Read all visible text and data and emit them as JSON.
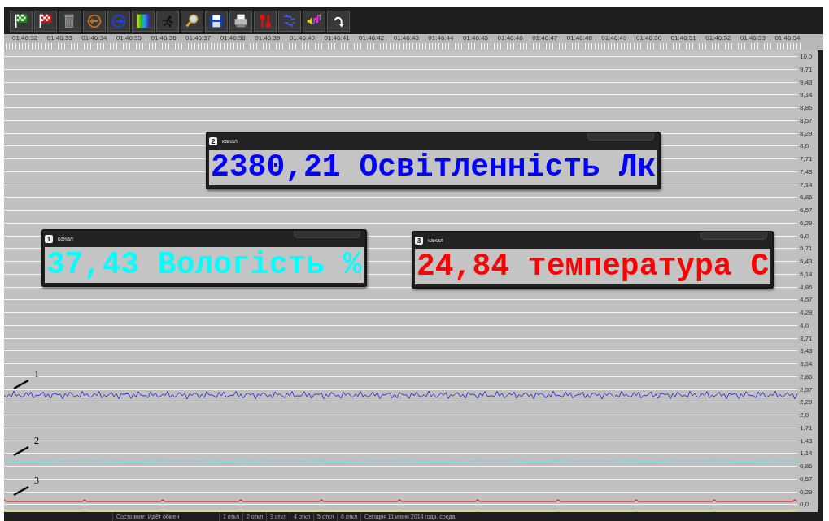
{
  "time_axis": {
    "labels": [
      "01:46:32",
      "01:46:33",
      "01:46:34",
      "01:46:35",
      "01:46:36",
      "01:46:37",
      "01:46:38",
      "01:46:39",
      "01:46:40",
      "01:46:41",
      "01:46:42",
      "01:46:43",
      "01:46:44",
      "01:46:45",
      "01:46:46",
      "01:46:47",
      "01:46:48",
      "01:46:49",
      "01:46:50",
      "01:46:51",
      "01:46:52",
      "01:46:53",
      "01:46:54"
    ]
  },
  "value_axis": {
    "labels": [
      "10,0",
      "9,71",
      "9,43",
      "9,14",
      "8,86",
      "8,57",
      "8,29",
      "8,0",
      "7,71",
      "7,43",
      "7,14",
      "6,86",
      "6,57",
      "6,29",
      "6,0",
      "5,71",
      "5,43",
      "5,14",
      "4,86",
      "4,57",
      "4,29",
      "4,0",
      "3,71",
      "3,43",
      "3,14",
      "2,86",
      "2,57",
      "2,29",
      "2,0",
      "1,71",
      "1,43",
      "1,14",
      "0,86",
      "0,57",
      "0,29",
      "0,0"
    ]
  },
  "traces": [
    {
      "label": "1",
      "color": "#3a3ac8"
    },
    {
      "label": "2",
      "color": "#70d8d8"
    },
    {
      "label": "3",
      "color": "#d04040"
    },
    {
      "color": "#e0e070"
    }
  ],
  "panels": [
    {
      "number": "2",
      "title": "канал",
      "value": "2380,21 Освітленність Лк",
      "color": "#0000ff"
    },
    {
      "number": "1",
      "title": "канал",
      "value": "37,43 Вологість %",
      "color": "#00ffff"
    },
    {
      "number": "3",
      "title": "канал",
      "value": "24,84 температура С",
      "color": "#ff0000"
    }
  ],
  "status_bar": {
    "state": "Состояние: Идёт обмен",
    "channels": [
      "1 откл",
      "2 откл",
      "3 откл",
      "4 откл",
      "5 откл",
      "6 откл"
    ],
    "date": "Сегодня 11 июня 2014 года, среда"
  }
}
